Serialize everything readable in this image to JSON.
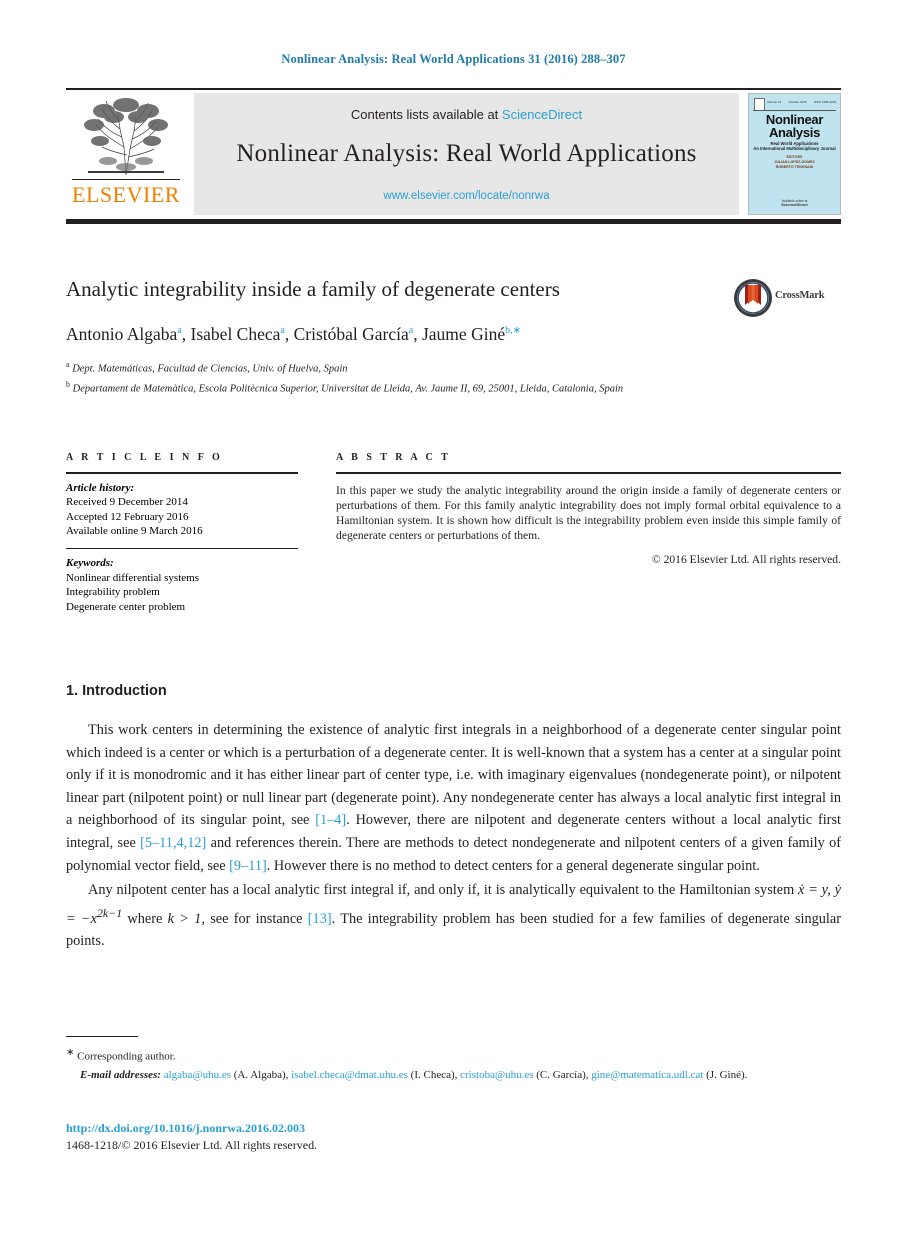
{
  "running_head": "Nonlinear Analysis: Real World Applications 31 (2016) 288–307",
  "masthead": {
    "contents_prefix": "Contents lists available at ",
    "sciencedirect": "ScienceDirect",
    "journal_name": "Nonlinear Analysis: Real World Applications",
    "journal_url": "www.elsevier.com/locate/nonrwa",
    "publisher": "ELSEVIER",
    "cover": {
      "vol_label": "Volume 31",
      "date_label": "October 2016",
      "issn_label": "ISSN 1468-1218",
      "title_line1": "Nonlinear",
      "title_line2": "Analysis",
      "subtitle_line1": "Real World Applications",
      "subtitle_line2": "An International Multidisciplinary Journal",
      "editors_line1": "EDITORS",
      "editors_line2": "JULIAN LOPEZ-GOMEZ",
      "editors_line3": "ROBERTO TRIGGIANI",
      "foot_small": "Available online at",
      "foot_big": "ScienceDirect"
    }
  },
  "article": {
    "title": "Analytic integrability inside a family of degenerate centers",
    "crossmark_label": "CrossMark",
    "authors_html": "Antonio Algaba<sup>a</sup>, Isabel Checa<sup>a</sup>, Cristóbal García<sup>a</sup>, Jaume Giné<sup>b,∗</sup>",
    "affiliation_a": "Dept. Matemáticas, Facultad de Ciencias, Univ. of Huelva, Spain",
    "affiliation_b": "Departament de Matemàtica, Escola Politècnica Superior, Universitat de Lleida, Av. Jaume II, 69, 25001, Lleida, Catalonia, Spain"
  },
  "info": {
    "heading": "A R T I C L E   I N F O",
    "history_label": "Article history:",
    "received": "Received 9 December 2014",
    "accepted": "Accepted 12 February 2016",
    "available": "Available online 9 March 2016",
    "keywords_label": "Keywords:",
    "keywords": [
      "Nonlinear differential systems",
      "Integrability problem",
      "Degenerate center problem"
    ]
  },
  "abstract": {
    "heading": "A B S T R A C T",
    "text": "In this paper we study the analytic integrability around the origin inside a family of degenerate centers or perturbations of them. For this family analytic integrability does not imply formal orbital equivalence to a Hamiltonian system. It is shown how difficult is the integrability problem even inside this simple family of degenerate centers or perturbations of them.",
    "copyright": "© 2016 Elsevier Ltd. All rights reserved."
  },
  "body": {
    "section_heading": "1. Introduction",
    "para1_a": "This work centers in determining the existence of analytic first integrals in a neighborhood of a degenerate center singular point which indeed is a center or which is a perturbation of a degenerate center. It is well-known that a system has a center at a singular point only if it is monodromic and it has either linear part of center type, i.e. with imaginary eigenvalues (nondegenerate point), or nilpotent linear part (nilpotent point) or null linear part (degenerate point). Any nondegenerate center has always a local analytic first integral in a neighborhood of its singular point, see ",
    "cite1": "[1–4]",
    "para1_b": ". However, there are nilpotent and degenerate centers without a local analytic first integral, see ",
    "cite2": "[5–11,4,12]",
    "para1_c": " and references therein. There are methods to detect nondegenerate and nilpotent centers of a given family of polynomial vector field, see ",
    "cite3": "[9–11]",
    "para1_d": ". However there is no method to detect centers for a general degenerate singular point.",
    "para2_a": "Any nilpotent center has a local analytic first integral if, and only if, it is analytically equivalent to the Hamiltonian system ",
    "math": "ẋ = y, ẏ = −x",
    "math_exp": "2k−1",
    "para2_b": " where ",
    "math_k": "k > 1",
    "para2_c": ", see for instance ",
    "cite4": "[13]",
    "para2_d": ". The integrability problem has been studied for a few families of degenerate singular points."
  },
  "footnotes": {
    "corresponding": "Corresponding author.",
    "star": "∗",
    "email_label": "E-mail addresses:",
    "emails": [
      {
        "address": "algaba@uhu.es",
        "person": "(A. Algaba)"
      },
      {
        "address": "isabel.checa@dmat.uhu.es",
        "person": "(I. Checa)"
      },
      {
        "address": "cristoba@uhu.es",
        "person": "(C. García)"
      },
      {
        "address": "gine@matematica.udl.cat",
        "person": "(J. Giné)"
      }
    ]
  },
  "bottom": {
    "doi": "http://dx.doi.org/10.1016/j.nonrwa.2016.02.003",
    "issn": "1468-1218/© 2016 Elsevier Ltd. All rights reserved."
  },
  "colors": {
    "link": "#2a9fd0",
    "elsevier_orange": "#f08000",
    "rule": "#231f20",
    "panel_grey": "#e7e7e7",
    "cover_blue": "#bfe3ef"
  }
}
